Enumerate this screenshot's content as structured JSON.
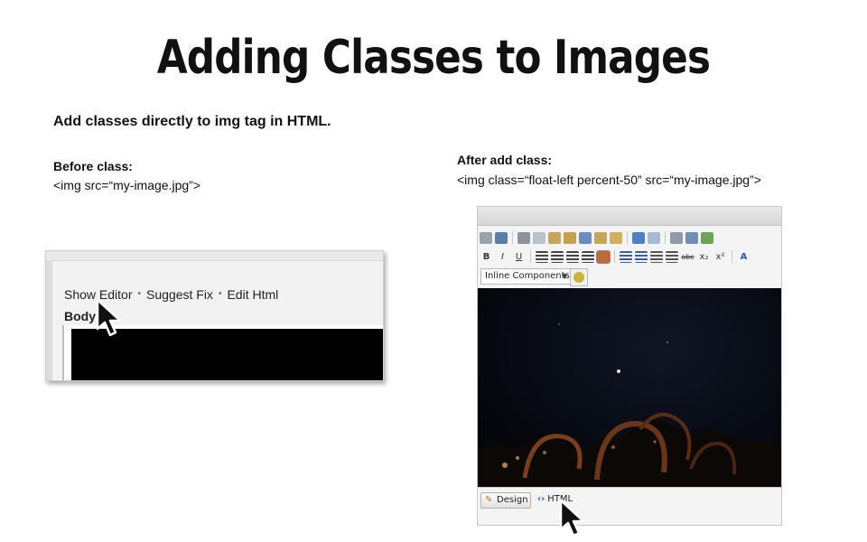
{
  "slide": {
    "title": "Adding Classes to Images",
    "intro": "Add classes directly to img tag in HTML.",
    "before_label": "Before class:",
    "before_code": "<img src=“my-image.jpg”>",
    "after_label": "After add class:",
    "after_code": "<img class=“float-left percent-50” src=“my-image.jpg”>"
  },
  "left_screenshot": {
    "links": [
      "Show Editor",
      "Suggest Fix",
      "Edit Html"
    ],
    "separator": "•",
    "body_label": "Body"
  },
  "right_screenshot": {
    "toolbar_row1": [
      "print-icon",
      "find-icon",
      "cut-icon",
      "copy-icon",
      "paste-icon",
      "paste-text-icon",
      "paste-word-icon",
      "paste-html-icon",
      "format-brush-icon",
      "undo-icon",
      "redo-icon",
      "link-icon",
      "anchor-icon",
      "image-icon"
    ],
    "toolbar_row2_labels": {
      "bold": "B",
      "italic": "I",
      "underline": "U",
      "strike": "abc",
      "subscript": "x₂",
      "superscript": "x²",
      "font_color": "A"
    },
    "inline_components": "Inline Components",
    "tabs": {
      "design": "Design",
      "html": "HTML"
    }
  },
  "colors": {
    "accent": "#2a5cb8",
    "editor_bg": "#05070d"
  }
}
